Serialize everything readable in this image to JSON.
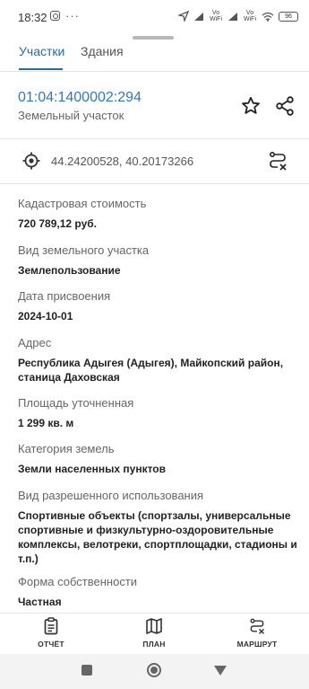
{
  "status_bar": {
    "time": "18:32",
    "dots": "···",
    "network_1": "Vo WiFi",
    "network_2": "Vo WiFi",
    "battery": "96"
  },
  "tabs": [
    {
      "label": "Участки",
      "active": true
    },
    {
      "label": "Здания",
      "active": false
    }
  ],
  "parcel": {
    "cadastral_number": "01:04:1400002:294",
    "type": "Земельный участок"
  },
  "coordinates": "44.24200528, 40.20173266",
  "fields": [
    {
      "label": "Кадастровая стоимость",
      "value": "720 789,12 руб."
    },
    {
      "label": "Вид земельного участка",
      "value": "Землепользование"
    },
    {
      "label": "Дата присвоения",
      "value": "2024-10-01"
    },
    {
      "label": "Адрес",
      "value": "Республика Адыгея (Адыгея), Майкопский район, станица Даховская"
    },
    {
      "label": "Площадь уточненная",
      "value": "1 299 кв. м"
    },
    {
      "label": "Категория земель",
      "value": "Земли населенных пунктов"
    },
    {
      "label": "Вид разрешенного использования",
      "value": "Спортивные объекты (спортзалы, универсальные спортивные и физкультурно-оздоровительные комплексы, велотреки, спортплощадки, стадионы и т.п.)"
    },
    {
      "label": "Форма собственности",
      "value": "Частная"
    }
  ],
  "bottom_nav": [
    {
      "label": "ОТЧЁТ",
      "icon": "report-icon"
    },
    {
      "label": "ПЛАН",
      "icon": "map-icon"
    },
    {
      "label": "МАРШРУТ",
      "icon": "route-icon"
    }
  ],
  "colors": {
    "accent": "#1e6fa8",
    "link": "#2b7bb9"
  }
}
